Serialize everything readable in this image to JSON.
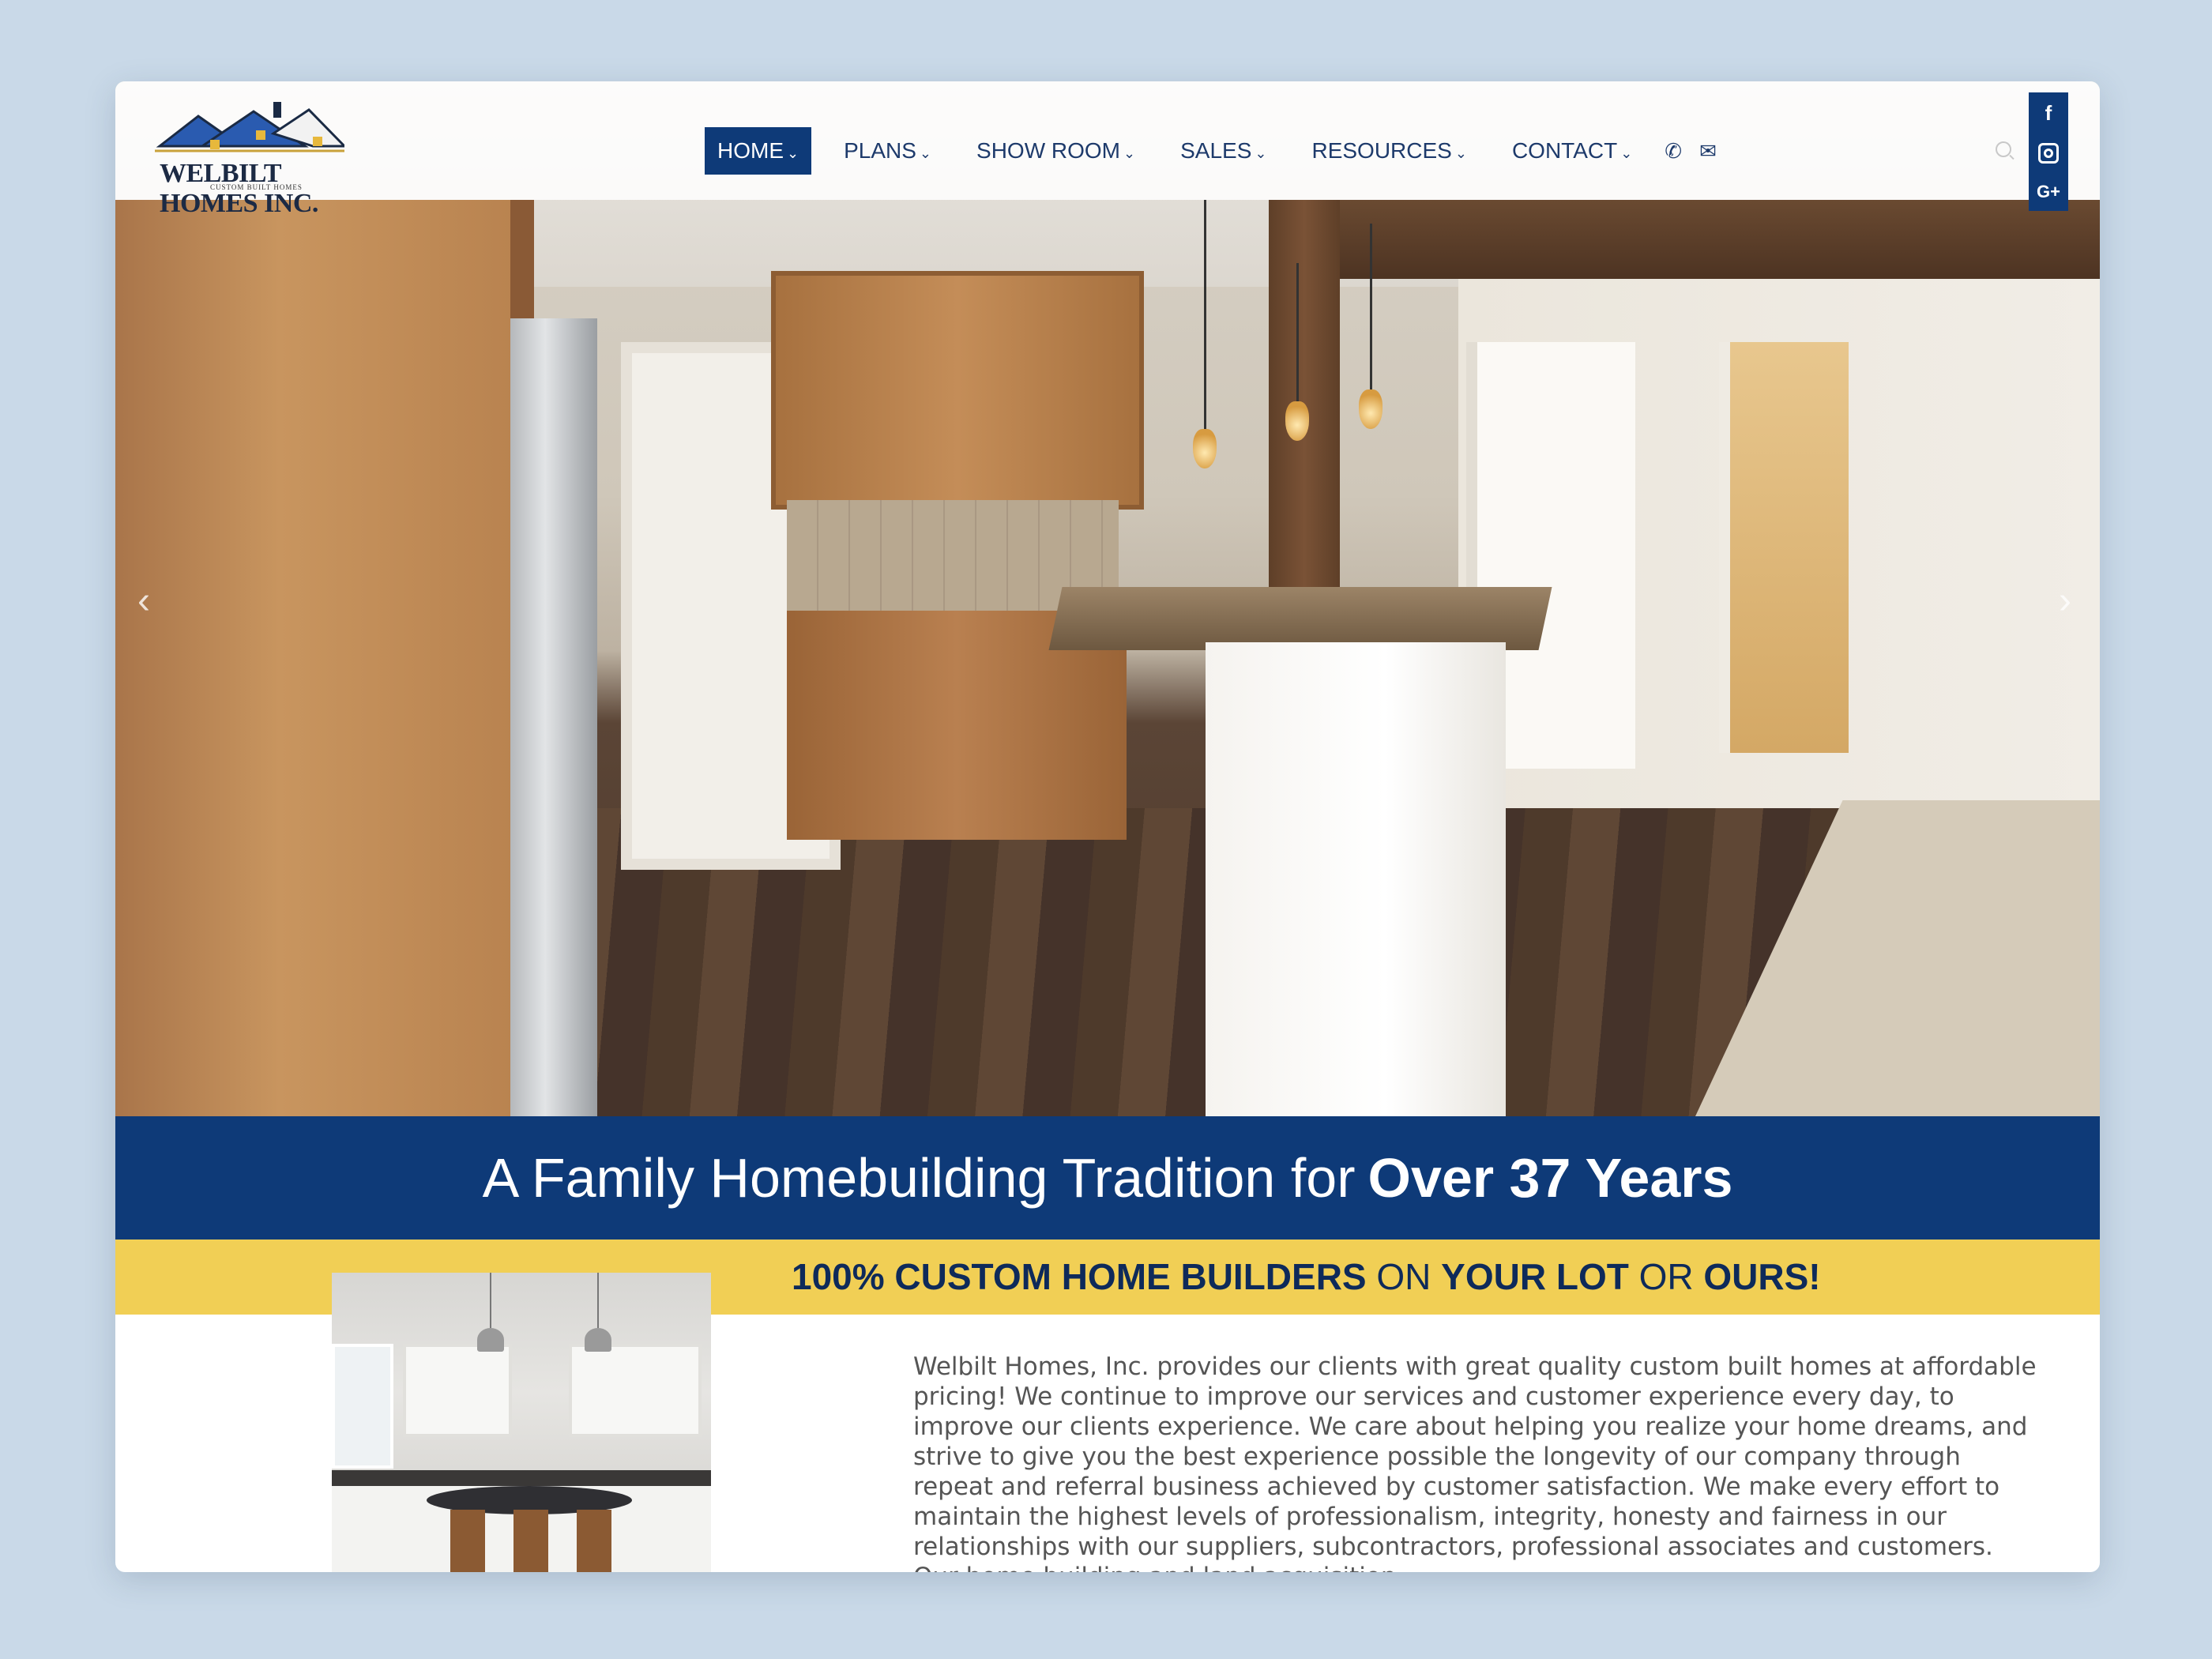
{
  "header": {
    "logo": {
      "brand_name": "WELBILT HOMES INC.",
      "tagline": "CUSTOM BUILT HOMES"
    },
    "nav": [
      {
        "label": "HOME",
        "active": true
      },
      {
        "label": "PLANS",
        "active": false
      },
      {
        "label": "SHOW ROOM",
        "active": false
      },
      {
        "label": "SALES",
        "active": false
      },
      {
        "label": "RESOURCES",
        "active": false
      },
      {
        "label": "CONTACT",
        "active": false
      }
    ],
    "contact_icons": [
      "phone-icon",
      "envelope-icon"
    ],
    "social": [
      "facebook-icon",
      "instagram-icon",
      "google-plus-icon"
    ]
  },
  "hero": {
    "image": "kitchen-interior-photo",
    "prev_arrow": "‹",
    "next_arrow": "›"
  },
  "tagline": {
    "prefix": "A Family Homebuilding Tradition for",
    "emphasis": "Over 37 Years"
  },
  "custom_band": {
    "part1": "100% CUSTOM HOME BUILDERS",
    "part2": "ON",
    "part3": "YOUR LOT",
    "part4": "OR",
    "part5": "OURS!"
  },
  "intro": {
    "text": "Welbilt Homes, Inc. provides our clients with great quality custom built homes at affordable pricing! We continue to improve our services and customer experience every day, to improve our clients experience. We care about helping you realize your home dreams, and strive to give you the best experience possible the longevity of our company through repeat and referral business achieved by customer satisfaction. We make every effort to maintain the highest levels of professionalism, integrity, honesty and fairness in our relationships with our suppliers, subcontractors, professional associates and customers. Our home building and land acquisition"
  },
  "colors": {
    "brand_navy": "#0e3a78",
    "brand_yellow": "#f1cf55",
    "page_background": "#c9d9e8"
  }
}
